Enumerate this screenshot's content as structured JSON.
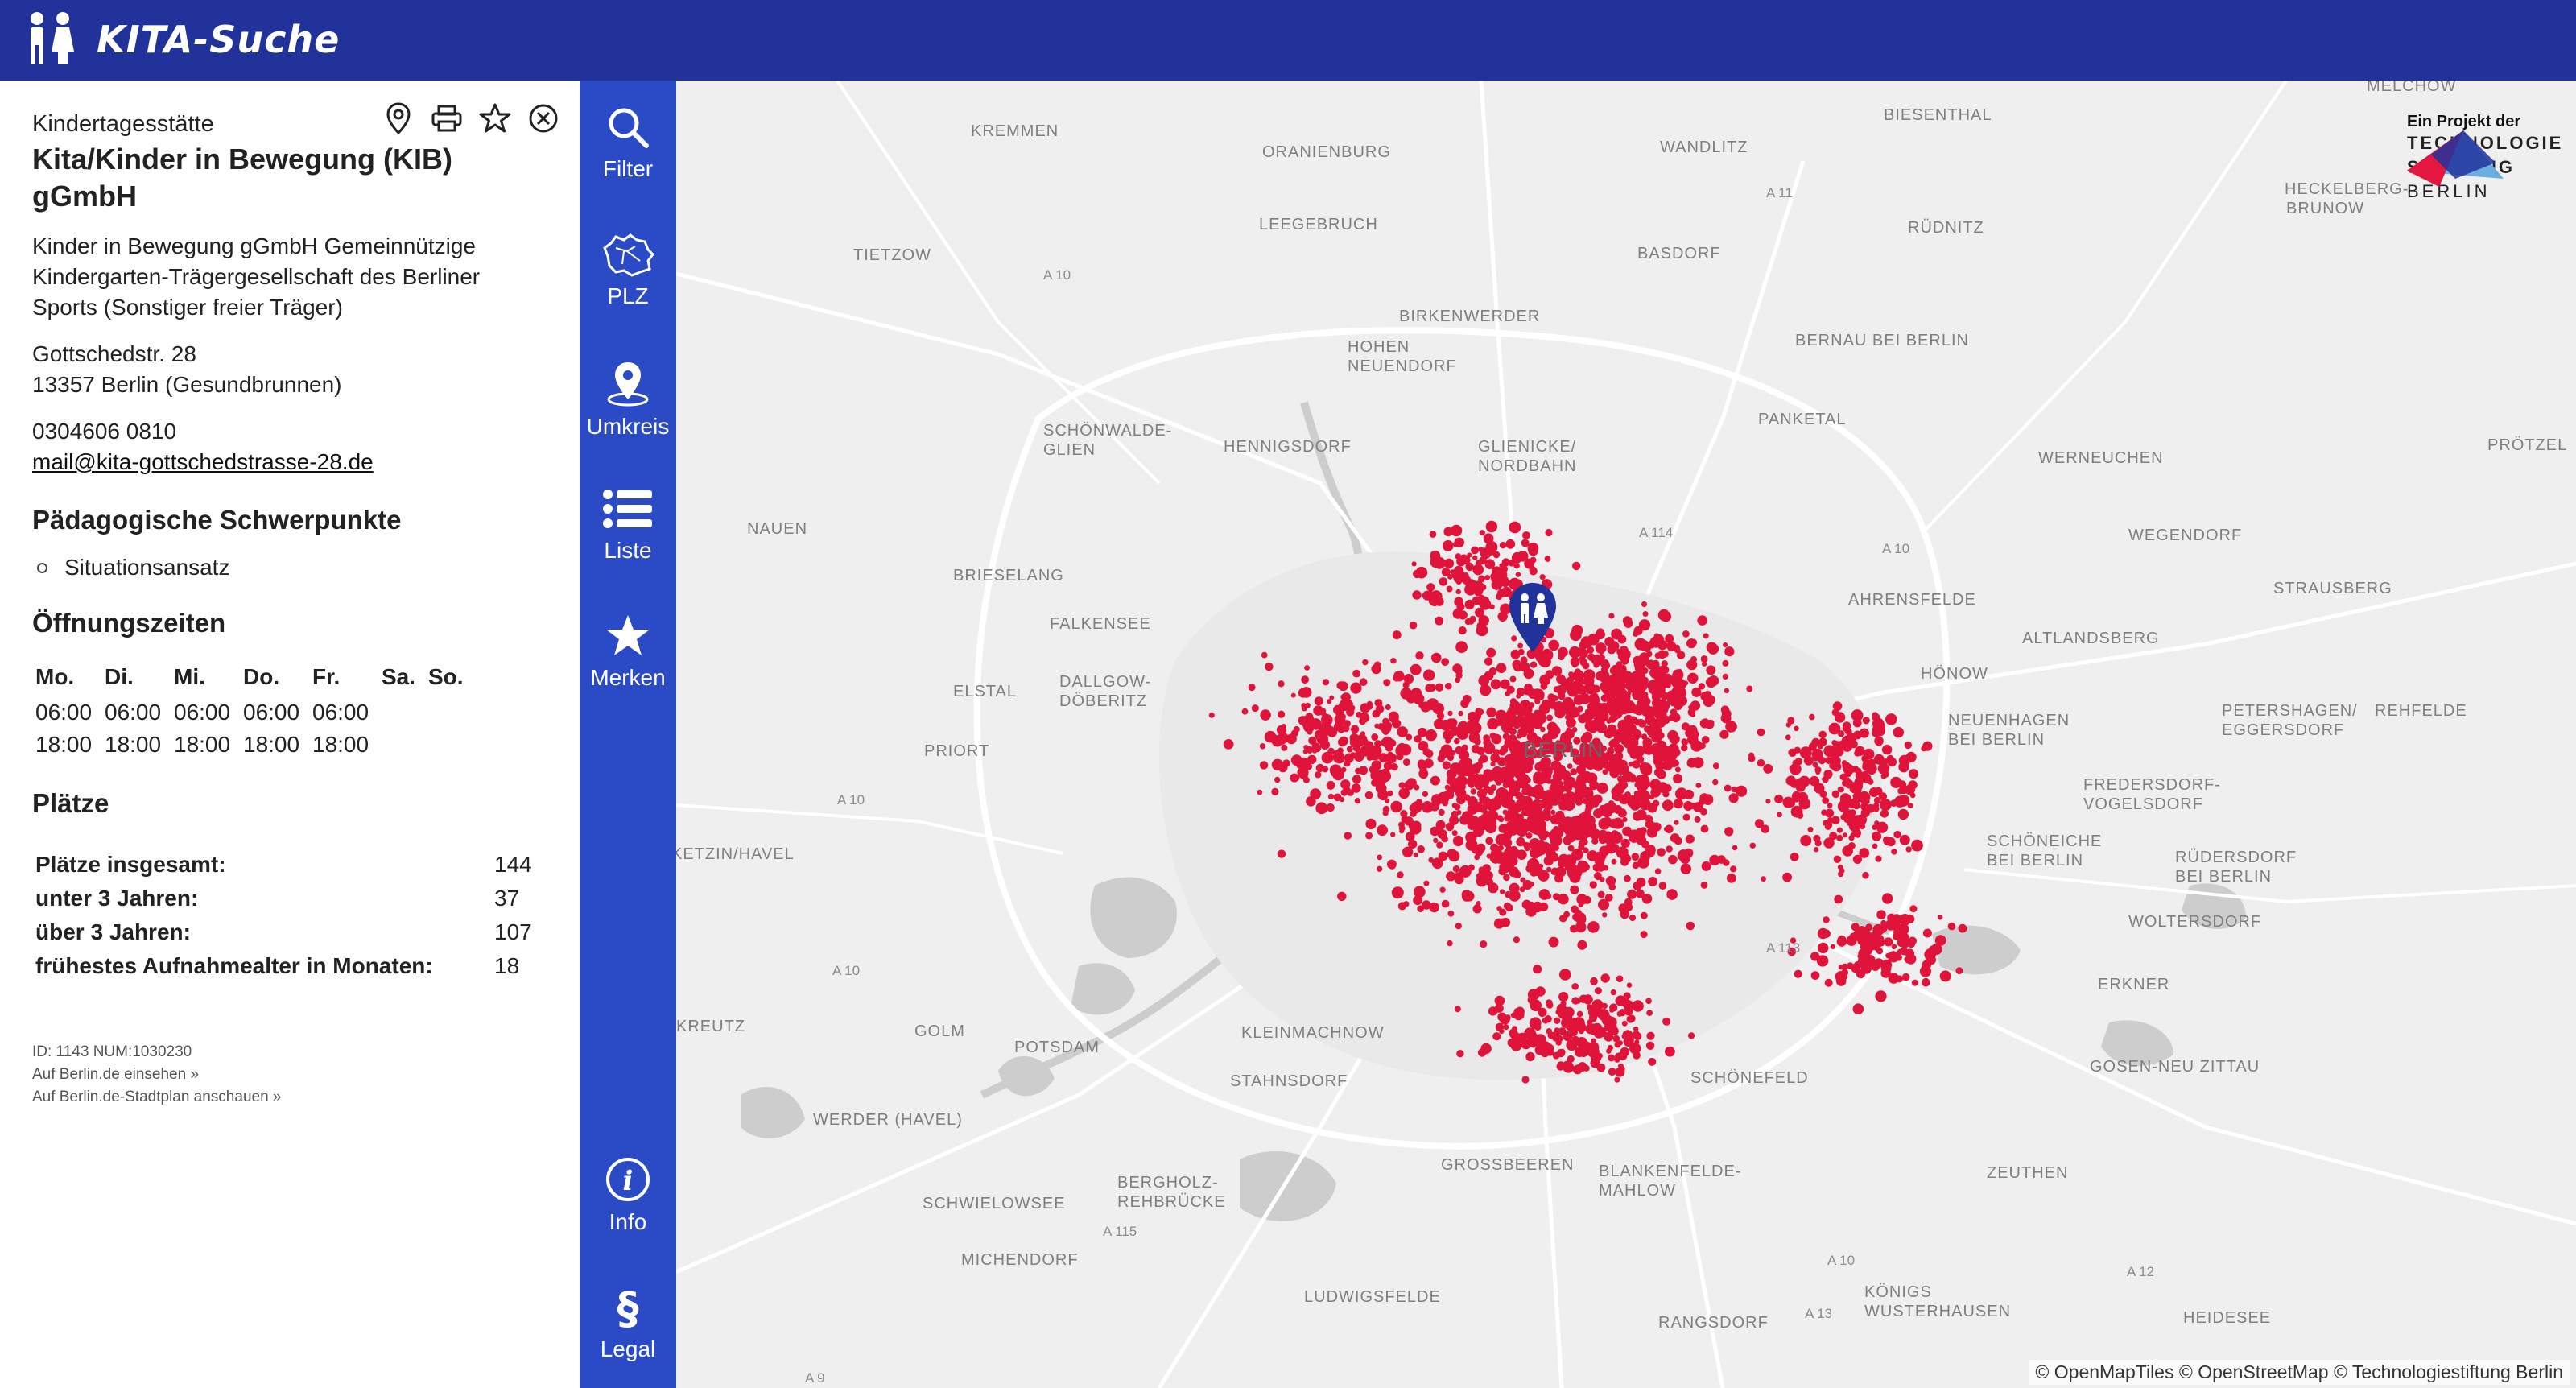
{
  "app": {
    "title": "KITA-Suche"
  },
  "detail": {
    "type": "Kindertagesstätte",
    "name": "Kita/Kinder in Bewegung (KIB) gGmbH",
    "operator": "Kinder in Bewegung gGmbH Gemeinnützige Kindergarten-Trägergesellschaft des Berliner Sports (Sonstiger freier Träger)",
    "street": "Gottschedstr. 28",
    "city": "13357 Berlin (Gesundbrunnen)",
    "phone": "0304606 0810",
    "email": "mail@kita-gottschedstrasse-28.de",
    "focus_title": "Pädagogische Schwerpunkte",
    "focus_items": [
      "Situationsansatz"
    ],
    "hours_title": "Öffnungszeiten",
    "hours": {
      "days": [
        "Mo.",
        "Di.",
        "Mi.",
        "Do.",
        "Fr.",
        "Sa.",
        "So."
      ],
      "open": [
        "06:00",
        "06:00",
        "06:00",
        "06:00",
        "06:00",
        "",
        ""
      ],
      "close": [
        "18:00",
        "18:00",
        "18:00",
        "18:00",
        "18:00",
        "",
        ""
      ]
    },
    "places_title": "Plätze",
    "places": [
      {
        "label": "Plätze insgesamt:",
        "value": "144"
      },
      {
        "label": "unter 3 Jahren:",
        "value": "37"
      },
      {
        "label": "über 3 Jahren:",
        "value": "107"
      },
      {
        "label": "frühestes Aufnahmealter in Monaten:",
        "value": "18"
      }
    ],
    "id_line": "ID: 1143 NUM:1030230",
    "link_berlin": "Auf Berlin.de einsehen »",
    "link_stadtplan": "Auf Berlin.de-Stadtplan anschauen »"
  },
  "panel_actions": [
    "location-pin-icon",
    "print-icon",
    "star-outline-icon",
    "close-circle-icon"
  ],
  "nav": {
    "filter": "Filter",
    "plz": "PLZ",
    "umkreis": "Umkreis",
    "liste": "Liste",
    "merken": "Merken",
    "info": "Info",
    "legal": "Legal"
  },
  "map": {
    "attribution": "© OpenMapTiles © OpenStreetMap © Technologiestiftung Berlin",
    "project_prefix": "Ein Projekt der",
    "project_name_1": "TECHNOLOGIE",
    "project_name_2": "STIFTUNG",
    "project_name_3": "BERLIN",
    "city_label": "BERLIN",
    "places": [
      "KREMMEN",
      "ORANIENBURG",
      "WANDLITZ",
      "BIESENTHAL",
      "MELCHOW",
      "TIETZOW",
      "LEEGEBRUCH",
      "RÜDNITZ",
      "HECKELBERG-",
      "BRUNOW",
      "BASDORF",
      "BIRKENWERDER",
      "HOHEN",
      "NEUENDORF",
      "BERNAU BEI BERLIN",
      "SCHÖNWALDE-",
      "GLIEN",
      "HENNIGSDORF",
      "GLIENICKE/",
      "NORDBAHN",
      "PANKETAL",
      "WERNEUCHEN",
      "PRÖTZEL",
      "NAUEN",
      "WEGENDORF",
      "BRIESELANG",
      "AHRENSFELDE",
      "STRAUSBERG",
      "FALKENSEE",
      "ALTLANDSBERG",
      "ELSTAL",
      "DALLGOW-",
      "DÖBERITZ",
      "HÖNOW",
      "NEUENHAGEN",
      "BEI BERLIN",
      "PETERSHAGEN/",
      "EGGERSDORF",
      "REHFELDE",
      "PRIORT",
      "FREDERSDORF-",
      "VOGELSDORF",
      "KETZIN/HAVEL",
      "SCHÖNEICHE",
      "BEI BERLIN",
      "RÜDERSDORF",
      "BEI BERLIN",
      "WOLTERSDORF",
      "KREUTZ",
      "GOLM",
      "POTSDAM",
      "KLEINMACHNOW",
      "STAHNSDORF",
      "SCHÖNEFELD",
      "ERKNER",
      "GOSEN-NEU ZITTAU",
      "WERDER (HAVEL)",
      "SCHWIELOWSEE",
      "BERGHOLZ-",
      "REHBRÜCKE",
      "GROSSBEEREN",
      "BLANKENFELDE-",
      "MAHLOW",
      "ZEUTHEN",
      "MICHENDORF",
      "LUDWIGSFELDE",
      "KÖNIGS",
      "WUSTERHAUSEN",
      "RANGSDORF",
      "HEIDESEE"
    ],
    "roads": [
      "A 11",
      "A 10",
      "A 114",
      "A 10",
      "A 10",
      "A 113",
      "A 10",
      "A 115",
      "A 10",
      "A 12",
      "A 13",
      "A 9"
    ]
  }
}
